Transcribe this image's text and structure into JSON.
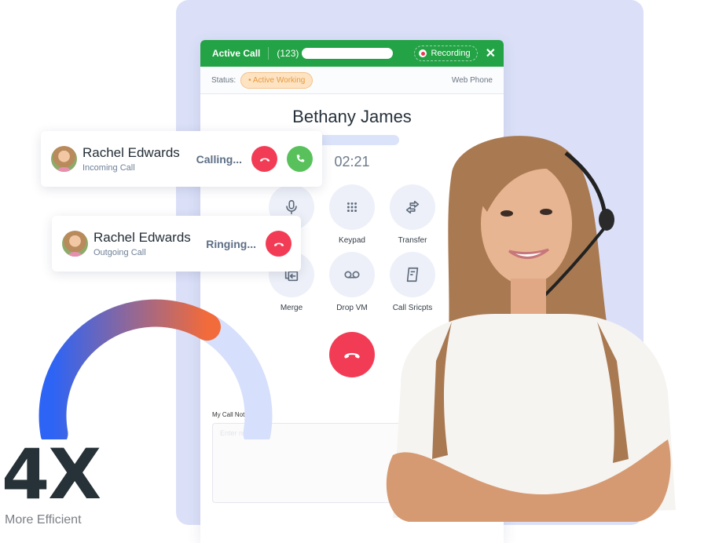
{
  "active_call": {
    "title": "Active Call",
    "number_prefix": "(123)",
    "recording_label": "Recording",
    "close_icon": "close-icon",
    "status_label": "Status:",
    "status_value": "• Active Working",
    "mode": "Web Phone",
    "callee_name": "Bethany James",
    "timer": "02:21",
    "actions": [
      {
        "label": "",
        "icon": "microphone-icon"
      },
      {
        "label": "Keypad",
        "icon": "keypad-icon"
      },
      {
        "label": "Transfer",
        "icon": "transfer-icon"
      },
      {
        "label": "Merge",
        "icon": "merge-icon"
      },
      {
        "label": "Drop VM",
        "icon": "voicemail-icon"
      },
      {
        "label": "Call Sricpts",
        "icon": "script-icon"
      }
    ],
    "hangup_icon": "hang-up-icon",
    "notes_label": "My Call Notes",
    "notes_placeholder": "Enter note",
    "notes_value": ""
  },
  "call_cards": [
    {
      "name": "Rachel Edwards",
      "type": "Incoming Call",
      "state": "Calling...",
      "buttons": [
        "decline",
        "accept"
      ]
    },
    {
      "name": "Rachel Edwards",
      "type": "Outgoing Call",
      "state": "Ringing...",
      "buttons": [
        "decline"
      ]
    }
  ],
  "stat": {
    "value": "4X",
    "caption": "More Efficient",
    "gauge_fraction": 0.65
  },
  "colors": {
    "brand_green": "#23a345",
    "decline_red": "#f23c55",
    "accept_green": "#58c15b",
    "panel_bg": "#dbe0f8",
    "gauge_start": "#2d64f5",
    "gauge_end": "#f26b3a",
    "gauge_track": "#d6dffb",
    "status_orange": "#e79a3f"
  }
}
